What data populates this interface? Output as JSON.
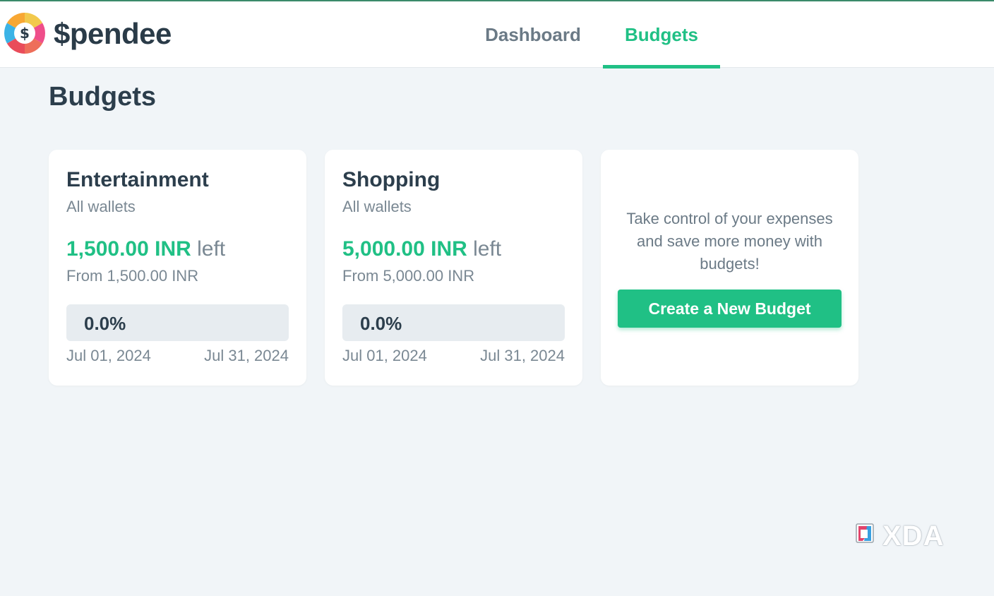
{
  "app": {
    "brand": "$pendee"
  },
  "nav": {
    "tabs": [
      {
        "label": "Dashboard",
        "active": false
      },
      {
        "label": "Budgets",
        "active": true
      }
    ]
  },
  "page": {
    "title": "Budgets"
  },
  "budgets": [
    {
      "name": "Entertainment",
      "wallets": "All wallets",
      "amount_left": "1,500.00 INR",
      "left_suffix": "left",
      "from": "From 1,500.00 INR",
      "progress_label": "0.0%",
      "progress_fraction": 0.0,
      "start_date": "Jul 01, 2024",
      "end_date": "Jul 31, 2024"
    },
    {
      "name": "Shopping",
      "wallets": "All wallets",
      "amount_left": "5,000.00 INR",
      "left_suffix": "left",
      "from": "From 5,000.00 INR",
      "progress_label": "0.0%",
      "progress_fraction": 0.0,
      "start_date": "Jul 01, 2024",
      "end_date": "Jul 31, 2024"
    }
  ],
  "promo": {
    "text": "Take control of your expenses and save more money with budgets!",
    "button_label": "Create a New Budget"
  },
  "watermark": {
    "text": "XDA"
  },
  "colors": {
    "accent": "#20c085",
    "text_dark": "#2c3e4c",
    "text_muted": "#7a8893",
    "background": "#f1f5f8"
  },
  "icons": {
    "logo": "spendee-logo-icon",
    "watermark": "xda-logo-icon"
  }
}
